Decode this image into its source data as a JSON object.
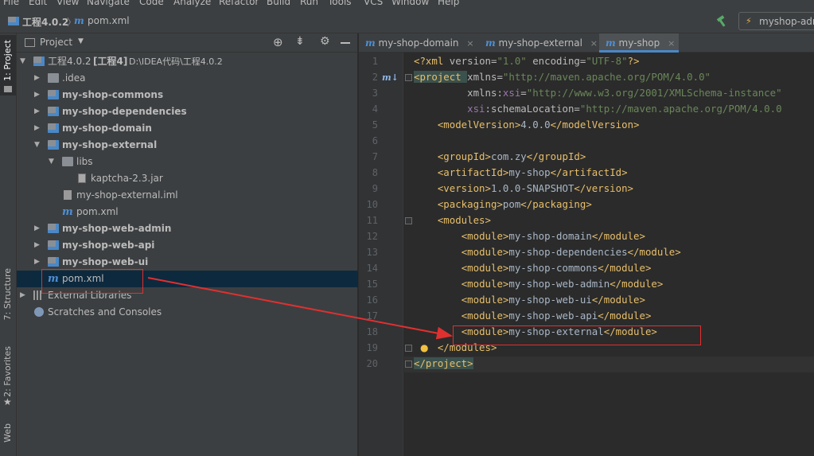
{
  "menu": [
    "File",
    "Edit",
    "View",
    "Navigate",
    "Code",
    "Analyze",
    "Refactor",
    "Build",
    "Run",
    "Tools",
    "VCS",
    "Window",
    "Help"
  ],
  "navbar": {
    "project_name": "工程4.0.2",
    "file_name": "pom.xml",
    "run_config": "myshop-adr"
  },
  "tool_strip": {
    "project": "1: Project",
    "structure": "7: Structure",
    "favorites": "2: Favorites",
    "web": "Web"
  },
  "project_panel": {
    "title": "Project",
    "tree": [
      {
        "label": "工程4.0.2",
        "extra": "[工程4]",
        "path": "D:\\IDEA代码\\工程4.0.2"
      },
      {
        "label": ".idea"
      },
      {
        "label": "my-shop-commons"
      },
      {
        "label": "my-shop-dependencies"
      },
      {
        "label": "my-shop-domain"
      },
      {
        "label": "my-shop-external"
      },
      {
        "label": "libs"
      },
      {
        "label": "kaptcha-2.3.jar"
      },
      {
        "label": "my-shop-external.iml"
      },
      {
        "label": "pom.xml"
      },
      {
        "label": "my-shop-web-admin"
      },
      {
        "label": "my-shop-web-api"
      },
      {
        "label": "my-shop-web-ui"
      },
      {
        "label": "pom.xml"
      },
      {
        "label": "External Libraries"
      },
      {
        "label": "Scratches and Consoles"
      }
    ]
  },
  "editor": {
    "tabs": [
      {
        "label": "my-shop-domain"
      },
      {
        "label": "my-shop-external"
      },
      {
        "label": "my-shop"
      }
    ],
    "lines": [
      {
        "n": "1",
        "parts": [
          [
            "tg",
            "<?xml "
          ],
          [
            "at",
            "version="
          ],
          [
            "av",
            "\"1.0\" "
          ],
          [
            "at",
            "encoding="
          ],
          [
            "av",
            "\"UTF-8\""
          ],
          [
            "tg",
            "?>"
          ]
        ]
      },
      {
        "n": "2",
        "parts": [
          [
            "tg",
            "<project "
          ],
          [
            "at",
            "xmlns="
          ],
          [
            "av",
            "\"http://maven.apache.org/POM/4.0.0\""
          ]
        ]
      },
      {
        "n": "3",
        "parts": [
          [
            "tx",
            "         "
          ],
          [
            "at",
            "xmlns:"
          ],
          [
            "ns",
            "xsi"
          ],
          [
            "at",
            "="
          ],
          [
            "av",
            "\"http://www.w3.org/2001/XMLSchema-instance\""
          ]
        ]
      },
      {
        "n": "4",
        "parts": [
          [
            "tx",
            "         "
          ],
          [
            "ns",
            "xsi"
          ],
          [
            "at",
            ":schemaLocation="
          ],
          [
            "av",
            "\"http://maven.apache.org/POM/4.0.0"
          ]
        ]
      },
      {
        "n": "5",
        "parts": [
          [
            "tx",
            "    "
          ],
          [
            "tg",
            "<modelVersion>"
          ],
          [
            "tx",
            "4.0.0"
          ],
          [
            "tg",
            "</modelVersion>"
          ]
        ]
      },
      {
        "n": "6",
        "parts": []
      },
      {
        "n": "7",
        "parts": [
          [
            "tx",
            "    "
          ],
          [
            "tg",
            "<groupId>"
          ],
          [
            "tx",
            "com.zy"
          ],
          [
            "tg",
            "</groupId>"
          ]
        ]
      },
      {
        "n": "8",
        "parts": [
          [
            "tx",
            "    "
          ],
          [
            "tg",
            "<artifactId>"
          ],
          [
            "tx",
            "my-shop"
          ],
          [
            "tg",
            "</artifactId>"
          ]
        ]
      },
      {
        "n": "9",
        "parts": [
          [
            "tx",
            "    "
          ],
          [
            "tg",
            "<version>"
          ],
          [
            "tx",
            "1.0.0-SNAPSHOT"
          ],
          [
            "tg",
            "</version>"
          ]
        ]
      },
      {
        "n": "10",
        "parts": [
          [
            "tx",
            "    "
          ],
          [
            "tg",
            "<packaging>"
          ],
          [
            "tx",
            "pom"
          ],
          [
            "tg",
            "</packaging>"
          ]
        ]
      },
      {
        "n": "11",
        "parts": [
          [
            "tx",
            "    "
          ],
          [
            "tg",
            "<modules>"
          ]
        ]
      },
      {
        "n": "12",
        "parts": [
          [
            "tx",
            "        "
          ],
          [
            "tg",
            "<module>"
          ],
          [
            "tx",
            "my-shop-domain"
          ],
          [
            "tg",
            "</module>"
          ]
        ]
      },
      {
        "n": "13",
        "parts": [
          [
            "tx",
            "        "
          ],
          [
            "tg",
            "<module>"
          ],
          [
            "tx",
            "my-shop-dependencies"
          ],
          [
            "tg",
            "</module>"
          ]
        ]
      },
      {
        "n": "14",
        "parts": [
          [
            "tx",
            "        "
          ],
          [
            "tg",
            "<module>"
          ],
          [
            "tx",
            "my-shop-commons"
          ],
          [
            "tg",
            "</module>"
          ]
        ]
      },
      {
        "n": "15",
        "parts": [
          [
            "tx",
            "        "
          ],
          [
            "tg",
            "<module>"
          ],
          [
            "tx",
            "my-shop-web-admin"
          ],
          [
            "tg",
            "</module>"
          ]
        ]
      },
      {
        "n": "16",
        "parts": [
          [
            "tx",
            "        "
          ],
          [
            "tg",
            "<module>"
          ],
          [
            "tx",
            "my-shop-web-ui"
          ],
          [
            "tg",
            "</module>"
          ]
        ]
      },
      {
        "n": "17",
        "parts": [
          [
            "tx",
            "        "
          ],
          [
            "tg",
            "<module>"
          ],
          [
            "tx",
            "my-shop-web-api"
          ],
          [
            "tg",
            "</module>"
          ]
        ]
      },
      {
        "n": "18",
        "parts": [
          [
            "tx",
            "        "
          ],
          [
            "tg",
            "<module>"
          ],
          [
            "tx",
            "my-shop-external"
          ],
          [
            "tg",
            "</module>"
          ]
        ]
      },
      {
        "n": "19",
        "parts": [
          [
            "tx",
            "    "
          ],
          [
            "tg",
            "</modules>"
          ]
        ]
      },
      {
        "n": "20",
        "parts": [
          [
            "tg",
            "</project>"
          ]
        ]
      }
    ]
  },
  "colors": {
    "annotation": "#e03030",
    "accent": "#4a88c7",
    "selection": "#0d293e"
  },
  "icons": [
    "project-view-icon",
    "locate-icon",
    "collapse-icon",
    "settings-icon",
    "minimize-icon",
    "build-hammer-icon",
    "run-config-icon",
    "maven-icon",
    "bulb-icon"
  ]
}
